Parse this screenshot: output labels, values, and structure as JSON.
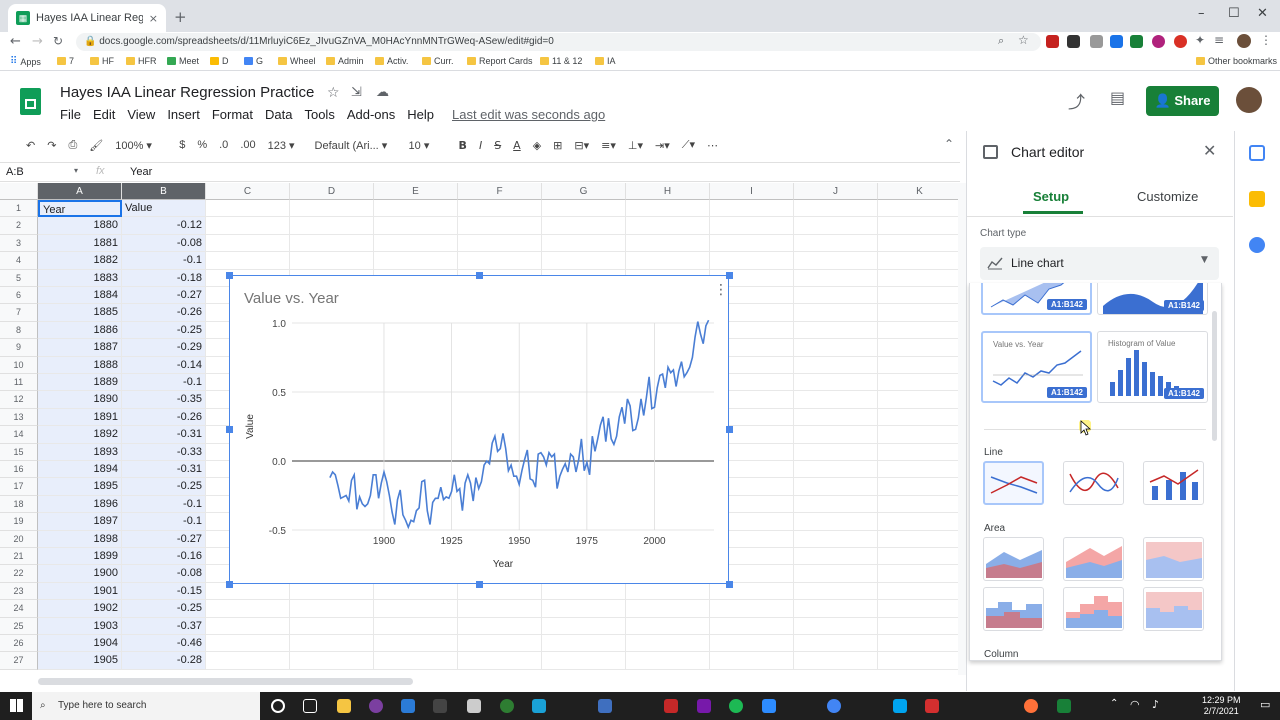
{
  "browser": {
    "tab_title": "Hayes IAA Linear Regression Prac",
    "url": "docs.google.com/spreadsheets/d/11MrluyiC6Ez_JIvuGZnVA_M0HAcYnnMNTrGWeq-ASew/edit#gid=0",
    "bookmarks": [
      "Apps",
      "7",
      "HF",
      "HFR",
      "Meet",
      "D",
      "G",
      "Wheel",
      "Admin",
      "Activ.",
      "Curr.",
      "Report Cards",
      "11 & 12",
      "IA"
    ],
    "other_bookmarks": "Other bookmarks"
  },
  "doc": {
    "title": "Hayes IAA Linear Regression Practice",
    "last_edit": "Last edit was seconds ago",
    "share_label": "Share",
    "menus": [
      "File",
      "Edit",
      "View",
      "Insert",
      "Format",
      "Data",
      "Tools",
      "Add-ons",
      "Help"
    ]
  },
  "toolbar": {
    "zoom": "100%",
    "currency": "$",
    "percent": "%",
    "dec_less": ".0",
    "dec_more": ".00",
    "format": "123",
    "font": "Default (Ari...",
    "size": "10"
  },
  "formula": {
    "name_box": "A:B",
    "fx": "fx",
    "value": "Year"
  },
  "sheet": {
    "columns": [
      "A",
      "B",
      "C",
      "D",
      "E",
      "F",
      "G",
      "H",
      "I",
      "J",
      "K"
    ],
    "rows": [
      [
        "Year",
        "Value"
      ],
      [
        "1880",
        "-0.12"
      ],
      [
        "1881",
        "-0.08"
      ],
      [
        "1882",
        "-0.1"
      ],
      [
        "1883",
        "-0.18"
      ],
      [
        "1884",
        "-0.27"
      ],
      [
        "1885",
        "-0.26"
      ],
      [
        "1886",
        "-0.25"
      ],
      [
        "1887",
        "-0.29"
      ],
      [
        "1888",
        "-0.14"
      ],
      [
        "1889",
        "-0.1"
      ],
      [
        "1890",
        "-0.35"
      ],
      [
        "1891",
        "-0.26"
      ],
      [
        "1892",
        "-0.31"
      ],
      [
        "1893",
        "-0.33"
      ],
      [
        "1894",
        "-0.31"
      ],
      [
        "1895",
        "-0.25"
      ],
      [
        "1896",
        "-0.1"
      ],
      [
        "1897",
        "-0.1"
      ],
      [
        "1898",
        "-0.27"
      ],
      [
        "1899",
        "-0.16"
      ],
      [
        "1900",
        "-0.08"
      ],
      [
        "1901",
        "-0.15"
      ],
      [
        "1902",
        "-0.25"
      ],
      [
        "1903",
        "-0.37"
      ],
      [
        "1904",
        "-0.46"
      ],
      [
        "1905",
        "-0.28"
      ]
    ]
  },
  "chart_data": {
    "type": "line",
    "title": "Value vs. Year",
    "xlabel": "Year",
    "ylabel": "Value",
    "xlim": [
      1866,
      2022
    ],
    "ylim": [
      -0.5,
      1.0
    ],
    "xticks": [
      1900,
      1925,
      1950,
      1975,
      2000
    ],
    "yticks": [
      "1.0",
      "0.5",
      "0.0",
      "-0.5"
    ],
    "grid": true,
    "series": [
      {
        "color": "#4a7ed4",
        "x_start": 1880,
        "values": [
          -0.12,
          -0.08,
          -0.1,
          -0.18,
          -0.27,
          -0.26,
          -0.25,
          -0.29,
          -0.14,
          -0.1,
          -0.35,
          -0.26,
          -0.31,
          -0.33,
          -0.31,
          -0.25,
          -0.1,
          -0.1,
          -0.27,
          -0.16,
          -0.08,
          -0.15,
          -0.25,
          -0.37,
          -0.46,
          -0.28,
          -0.21,
          -0.39,
          -0.43,
          -0.48,
          -0.43,
          -0.44,
          -0.36,
          -0.34,
          -0.15,
          -0.14,
          -0.36,
          -0.46,
          -0.3,
          -0.27,
          -0.27,
          -0.19,
          -0.28,
          -0.26,
          -0.27,
          -0.22,
          -0.1,
          -0.22,
          -0.2,
          -0.36,
          -0.16,
          -0.1,
          -0.16,
          -0.29,
          -0.12,
          -0.2,
          -0.15,
          -0.03,
          0.0,
          -0.02,
          0.13,
          0.18,
          0.07,
          0.09,
          0.2,
          0.09,
          -0.07,
          -0.03,
          -0.11,
          -0.11,
          -0.17,
          -0.07,
          0.01,
          0.08,
          -0.13,
          -0.14,
          -0.19,
          0.05,
          0.06,
          0.03,
          -0.03,
          0.06,
          0.03,
          0.05,
          -0.2,
          -0.11,
          -0.06,
          -0.02,
          -0.08,
          0.05,
          0.03,
          -0.08,
          0.01,
          0.16,
          -0.07,
          -0.01,
          -0.1,
          0.18,
          0.07,
          0.16,
          0.26,
          0.32,
          0.14,
          0.31,
          0.16,
          0.12,
          0.18,
          0.32,
          0.39,
          0.27,
          0.45,
          0.4,
          0.22,
          0.23,
          0.31,
          0.45,
          0.33,
          0.46,
          0.61,
          0.38,
          0.39,
          0.53,
          0.62,
          0.63,
          0.53,
          0.68,
          0.64,
          0.66,
          0.54,
          0.65,
          0.72,
          0.61,
          0.64,
          0.68,
          0.75,
          0.9,
          1.01,
          0.92,
          0.85,
          0.98,
          1.02
        ]
      }
    ]
  },
  "editor": {
    "title": "Chart editor",
    "tab_setup": "Setup",
    "tab_customize": "Customize",
    "chart_type_label": "Chart type",
    "chart_type": "Line chart",
    "thumb_range": "A1:B142",
    "thumb_caption_1": "Value vs. Year",
    "thumb_caption_2": "Histogram of Value",
    "sec_line": "Line",
    "sec_area": "Area",
    "sec_column": "Column"
  },
  "taskbar": {
    "search": "Type here to search",
    "time": "12:29 PM",
    "date": "2/7/2021"
  }
}
